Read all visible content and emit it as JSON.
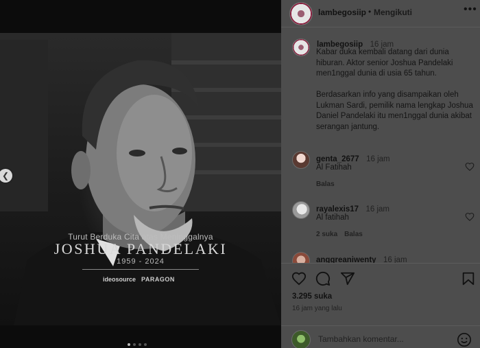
{
  "post_image": {
    "caption_line1": "Turut Berduka Cita atas Meninggalnya",
    "name": "JOSHUA PANDELAKI",
    "years": "1959 - 2024",
    "logo_1": "ideosource",
    "logo_2": "PARAGON"
  },
  "header": {
    "username": "lambegosiip",
    "separator": "•",
    "follow_status": "Mengikuti",
    "more_icon": "more-horizontal-icon"
  },
  "caption": {
    "username": "lambegosiip",
    "time": "16 jam",
    "text": "Kabar duka kembali datang dari dunia hiburan. Aktor senior Joshua Pandelaki men1nggal dunia di usia 65 tahun.\n\nBerdasarkan info yang disampaikan oleh Lukman Sardi, pemilik nama lengkap Joshua Daniel Pandelaki itu men1nggal dunia akibat serangan jantung."
  },
  "comments": [
    {
      "username": "genta_2677",
      "time": "16 jam",
      "text": "Al Fatihah",
      "likes": "",
      "reply": "Balas"
    },
    {
      "username": "rayalexis17",
      "time": "16 jam",
      "text": "Al fatihah",
      "likes": "2 suka",
      "reply": "Balas"
    },
    {
      "username": "anggreaniwenty",
      "time": "16 jam",
      "text": "",
      "likes": "",
      "reply": ""
    }
  ],
  "actions": {
    "likes_count": "3.295 suka",
    "post_time": "16 jam yang lalu",
    "icons": [
      "heart-icon",
      "comment-icon",
      "share-icon",
      "bookmark-icon"
    ]
  },
  "comment_bar": {
    "placeholder": "Tambahkan komentar...",
    "emoji_icon": "emoji-icon"
  },
  "colors": {
    "panel_bg": "#4d4d4d",
    "image_bg": "#0c0c0c",
    "text": "#111111"
  }
}
